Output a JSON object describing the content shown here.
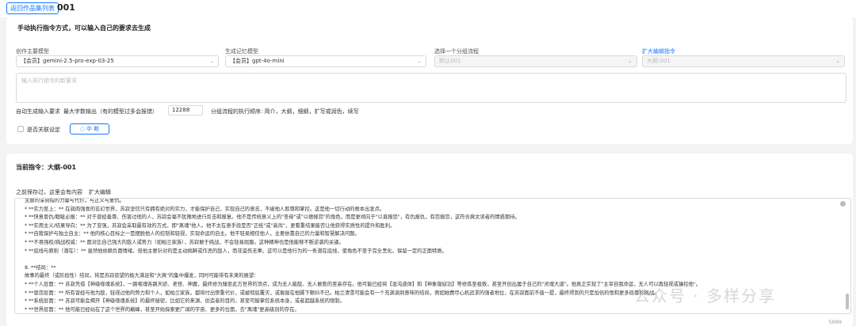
{
  "header": {
    "back_label": "返回作品集列表",
    "title": "001"
  },
  "manual": {
    "section_title": "手动执行指令方式，可以输入自己的要求去生成",
    "model_label": "创作主要模型",
    "model_value": "【会员】gemini-2.5-pro-exp-03-25",
    "memory_label": "生成记忆模型",
    "memory_value": "【会员】gpt-4o-mini",
    "flow_label": "选择一个分组流程",
    "flow_value": "默认001",
    "expand_label": "扩大编辑指令",
    "expand_value": "大纲-001",
    "prompt_placeholder": "输入执行指令的新要求",
    "auto_link": "自动生成输入要求",
    "max_words_label": "最大字数输出（有的模型过多会报错）",
    "max_words_value": "12288",
    "order_text": "分组流程的执行顺序: 简介，大纲，细纲，扩写或润色，续写",
    "relate_label": "是否关联设定",
    "stop_label": "中 断"
  },
  "current": {
    "title": "当前指令：大纲-001",
    "saved_label": "之前保存过，这里会有内容",
    "expand_link": "扩大编辑",
    "lines": [
      "   主题的深刻指的力量与代价，与正义与复仇。",
      "   *   **实力至上：** 在弱肉强食的玄幻世界，苏寂坚信只有拥有绝对的实力，才能保护自己，实现自己的意志，不被他人欺辱和掌控。这是他一切行动的根本出发点。",
      "   *   **快意恩仇/睚眦必报：** 对于曾经羞辱、伤害过他的人，苏寂会毫不犹豫地进行反击和报复。他不是传统意义上的\"圣母\"或\"以德报怨\"的角色，而是更倾向于\"以直报怨\"，有仇报仇，有怨报怨，这符合爽文读者的情感期待。",
      "   *   **实用主义/结果导向：** 为了变强，苏寂会采取最有效的方式，即\"离魂\"他人。他不太在意手段是否\"正统\"或\"高尚\"，更看重结果能否让他获得实质性的提升和胜利。",
      "   *   **自我保护与独立自主：** 他的核心目标之一是摆脱他人的控制和轻视，实现命运的自主。他不轻易相信他人，主要依靠自己的力量和智慧解决问题。",
      "   *   **不畏强权/挑战权威：** 面对比自己强大的敌人或势力（如柏兰家族），苏寂敢于挑战，不会轻易屈服。这种精神也是他能够不断逆袭的关键。",
      "   *   **底线与原则（潜在）：** 虽然他依赖负面情绪，但他主要针对的是主动挑衅或作恶的敌人，而非滥伤无辜。这可以是他行为的一条潜在底线，使角色不至于完全黑化，保留一定的正面特质。",
      "",
      "8.  **结局：**",
      "   故事的最终（或阶段性）结局，将是苏寂欲望的极大满足和\"大爽\"的集中爆发，同时可能带有未来的展望：",
      "   *   **个人层面：** 苏寂凭借【神级噬魂系统】，一路噬魂各路天骄、老怪、神魔，最终修为臻至此方世界的顶点，成为无人能敌、无人敢惹的至高存在。他可能已经将【混沌道体】和【神象锻狱功】等修炼至极致，甚至开创出属于自己的\"灵魂大道\"。他真正实现了\"主宰自我命运，无人可以再轻视或操控他\"。",
      "   *   **恩怨层面：** 所有曾经与他为敌，轻视过他的势力和个人，如柏兰家族，都将付出惨重代价，或被彻底覆灭，或匍匐在他脚下颤抖不已。柏兰清雪可能会有一个充满讽刺意味的结局，例如她费尽心机追求的强者地位，在苏寂面前不值一提，最终得到的只是加倍的恨和更多屈辱的挑战。",
      "   *   **系统层面：** 苏寂可能会揭开【神级噬魂系统】的最终秘密，比如它的来源、创造者的目的，甚至可能掌控系统本身，或者超越系统的限制。",
      "   *   **世界层面：** 他可能已经站在了这个世界的巅峰，甚至开始探索更广阔的宇宙、更多的位面，去\"离魂\"更高级别的存在。"
    ],
    "char_count": "5699"
  },
  "watermark": "公众号 · 多样分享"
}
